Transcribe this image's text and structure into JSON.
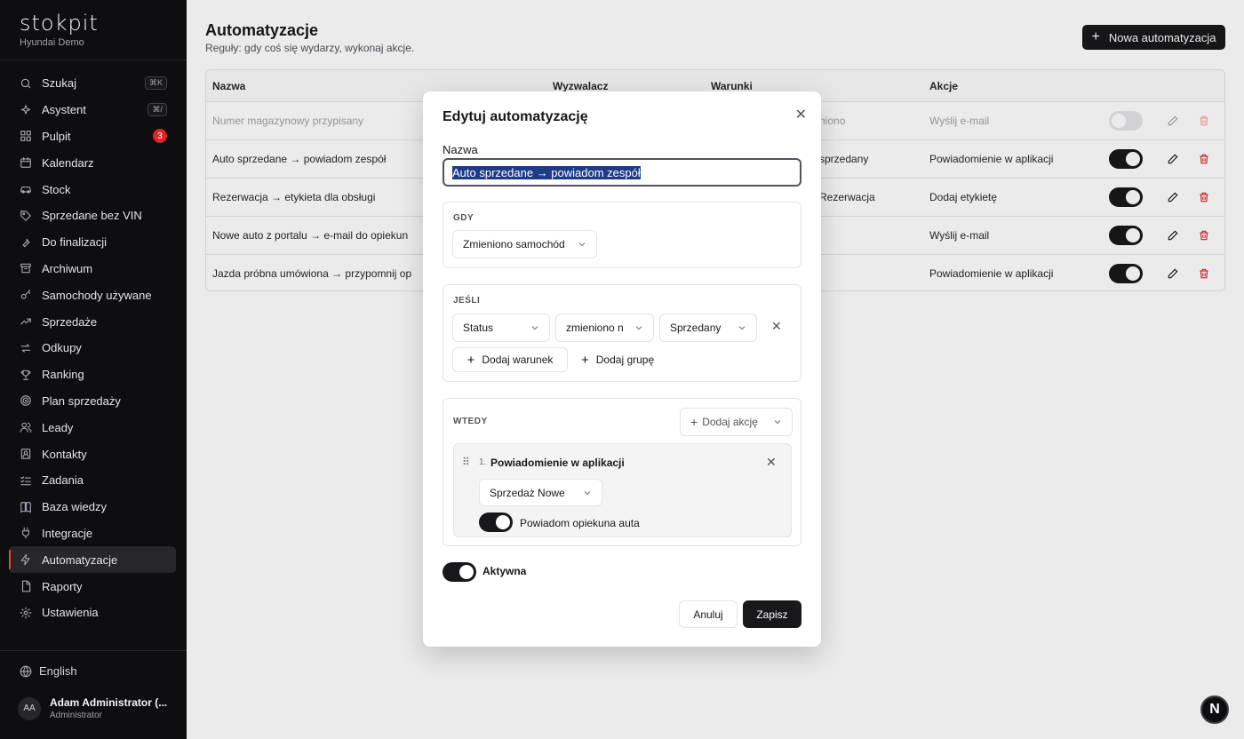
{
  "brand": {
    "name": "stokpit",
    "subtitle": "Hyundai Demo"
  },
  "sidebar": {
    "items": [
      {
        "label": "Szukaj",
        "icon": "search-icon",
        "kbd": "⌘K"
      },
      {
        "label": "Asystent",
        "icon": "sparkle-icon",
        "kbd": "⌘/"
      },
      {
        "label": "Pulpit",
        "icon": "dashboard-icon",
        "badge": "3"
      },
      {
        "label": "Kalendarz",
        "icon": "calendar-icon"
      },
      {
        "label": "Stock",
        "icon": "car-icon"
      },
      {
        "label": "Sprzedane bez VIN",
        "icon": "tag-icon"
      },
      {
        "label": "Do finalizacji",
        "icon": "wrench-icon"
      },
      {
        "label": "Archiwum",
        "icon": "archive-icon"
      },
      {
        "label": "Samochody używane",
        "icon": "key-icon"
      },
      {
        "label": "Sprzedaże",
        "icon": "trending-up-icon"
      },
      {
        "label": "Odkupy",
        "icon": "exchange-icon"
      },
      {
        "label": "Ranking",
        "icon": "trophy-icon"
      },
      {
        "label": "Plan sprzedaży",
        "icon": "target-icon"
      },
      {
        "label": "Leady",
        "icon": "users-icon"
      },
      {
        "label": "Kontakty",
        "icon": "contact-icon"
      },
      {
        "label": "Zadania",
        "icon": "list-check-icon"
      },
      {
        "label": "Baza wiedzy",
        "icon": "book-icon"
      },
      {
        "label": "Integracje",
        "icon": "plug-icon"
      },
      {
        "label": "Automatyzacje",
        "icon": "bolt-icon",
        "active": true
      },
      {
        "label": "Raporty",
        "icon": "file-icon"
      },
      {
        "label": "Ustawienia",
        "icon": "gear-icon"
      }
    ],
    "language": "English",
    "user": {
      "initials": "AA",
      "name": "Adam Administrator (...",
      "role": "Administrator"
    }
  },
  "page": {
    "title": "Automatyzacje",
    "subtitle": "Reguły: gdy coś się wydarzy, wykonaj akcje.",
    "new_button": "Nowa automatyzacja"
  },
  "table": {
    "headers": {
      "name": "Nazwa",
      "trigger": "Wyzwalacz",
      "conditions": "Warunki",
      "actions": "Akcje"
    },
    "rows": [
      {
        "name": "Numer magazynowy przypisany",
        "condition": "niono",
        "action": "Wyślij e-mail",
        "active": false
      },
      {
        "name": "Auto sprzedane → powiadom zespół",
        "condition": "sprzedany",
        "action": "Powiadomienie w aplikacji",
        "active": true
      },
      {
        "name": "Rezerwacja → etykieta dla obsługi",
        "condition": "Rezerwacja",
        "action": "Dodaj etykietę",
        "active": true
      },
      {
        "name": "Nowe auto z portalu → e-mail do opiekun",
        "condition": "",
        "action": "Wyślij e-mail",
        "active": true
      },
      {
        "name": "Jazda próbna umówiona → przypomnij op",
        "condition": "",
        "action": "Powiadomienie w aplikacji",
        "active": true
      }
    ]
  },
  "modal": {
    "title": "Edytuj automatyzację",
    "name_label": "Nazwa",
    "name_value": "Auto sprzedane → powiadom zespół",
    "when": {
      "label": "GDY",
      "trigger": "Zmieniono samochód"
    },
    "if": {
      "label": "JEŚLI",
      "field": "Status",
      "operator": "zmieniono n",
      "value": "Sprzedany",
      "add_condition": "Dodaj warunek",
      "add_group": "Dodaj grupę"
    },
    "then": {
      "label": "WTEDY",
      "add_action": "Dodaj akcję",
      "action": {
        "number": "1.",
        "title": "Powiadomienie w aplikacji",
        "target": "Sprzedaż Nowe",
        "toggle_label": "Powiadom opiekuna auta"
      }
    },
    "active_label": "Aktywna",
    "cancel": "Anuluj",
    "save": "Zapisz"
  },
  "dev_bubble": "N",
  "colors": {
    "sidebar_bg": "#0e0e10",
    "primary": "#18181b",
    "accent_red": "#dc2626"
  }
}
